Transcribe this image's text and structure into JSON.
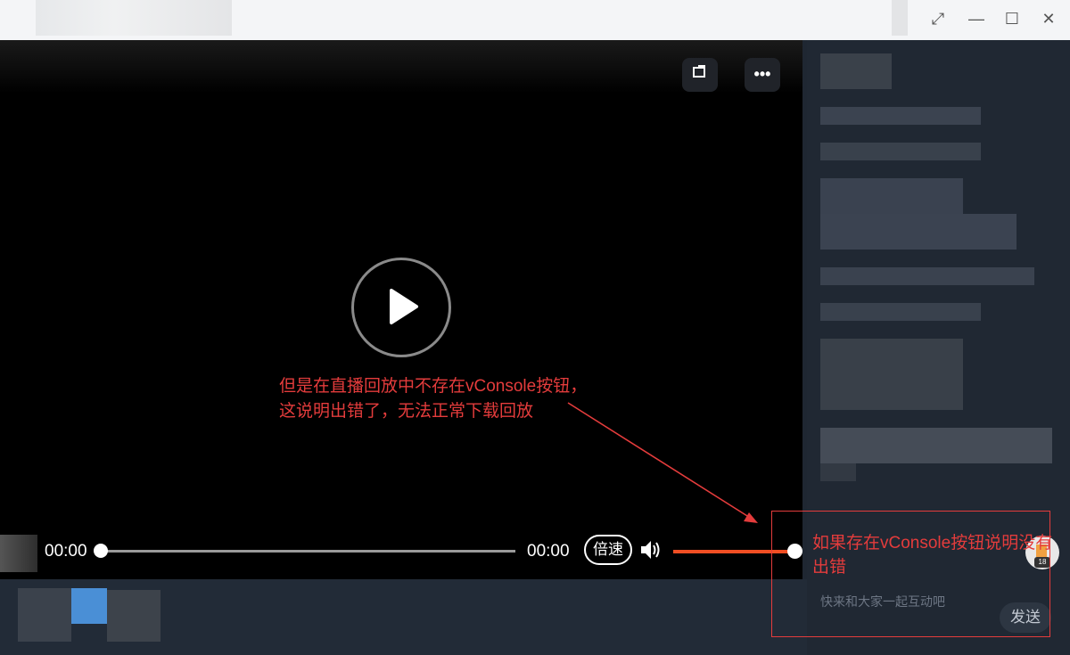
{
  "window": {
    "buttons": {
      "expand": "⤢",
      "minimize": "—",
      "maximize": "☐",
      "close": "✕"
    }
  },
  "player": {
    "current_time": "00:00",
    "duration": "00:00",
    "speed_label": "倍速",
    "progress": 0,
    "volume": 1.0,
    "icons": {
      "rotate": "rotate-icon",
      "more": "more-icon",
      "play": "play-icon",
      "volume": "volume-icon"
    }
  },
  "annotations": {
    "center_line1": "但是在直播回放中不存在vConsole按钮，",
    "center_line2": "这说明出错了，无法正常下载回放",
    "right": "如果存在vConsole按钮说明没有出错",
    "color": "#e43c3c"
  },
  "chat": {
    "placeholder": "快来和大家一起互动吧",
    "send_label": "发送",
    "avatar_badge": "18"
  },
  "colors": {
    "accent": "#f04e23",
    "annotation": "#e43c3c",
    "sidebar": "#202833"
  }
}
